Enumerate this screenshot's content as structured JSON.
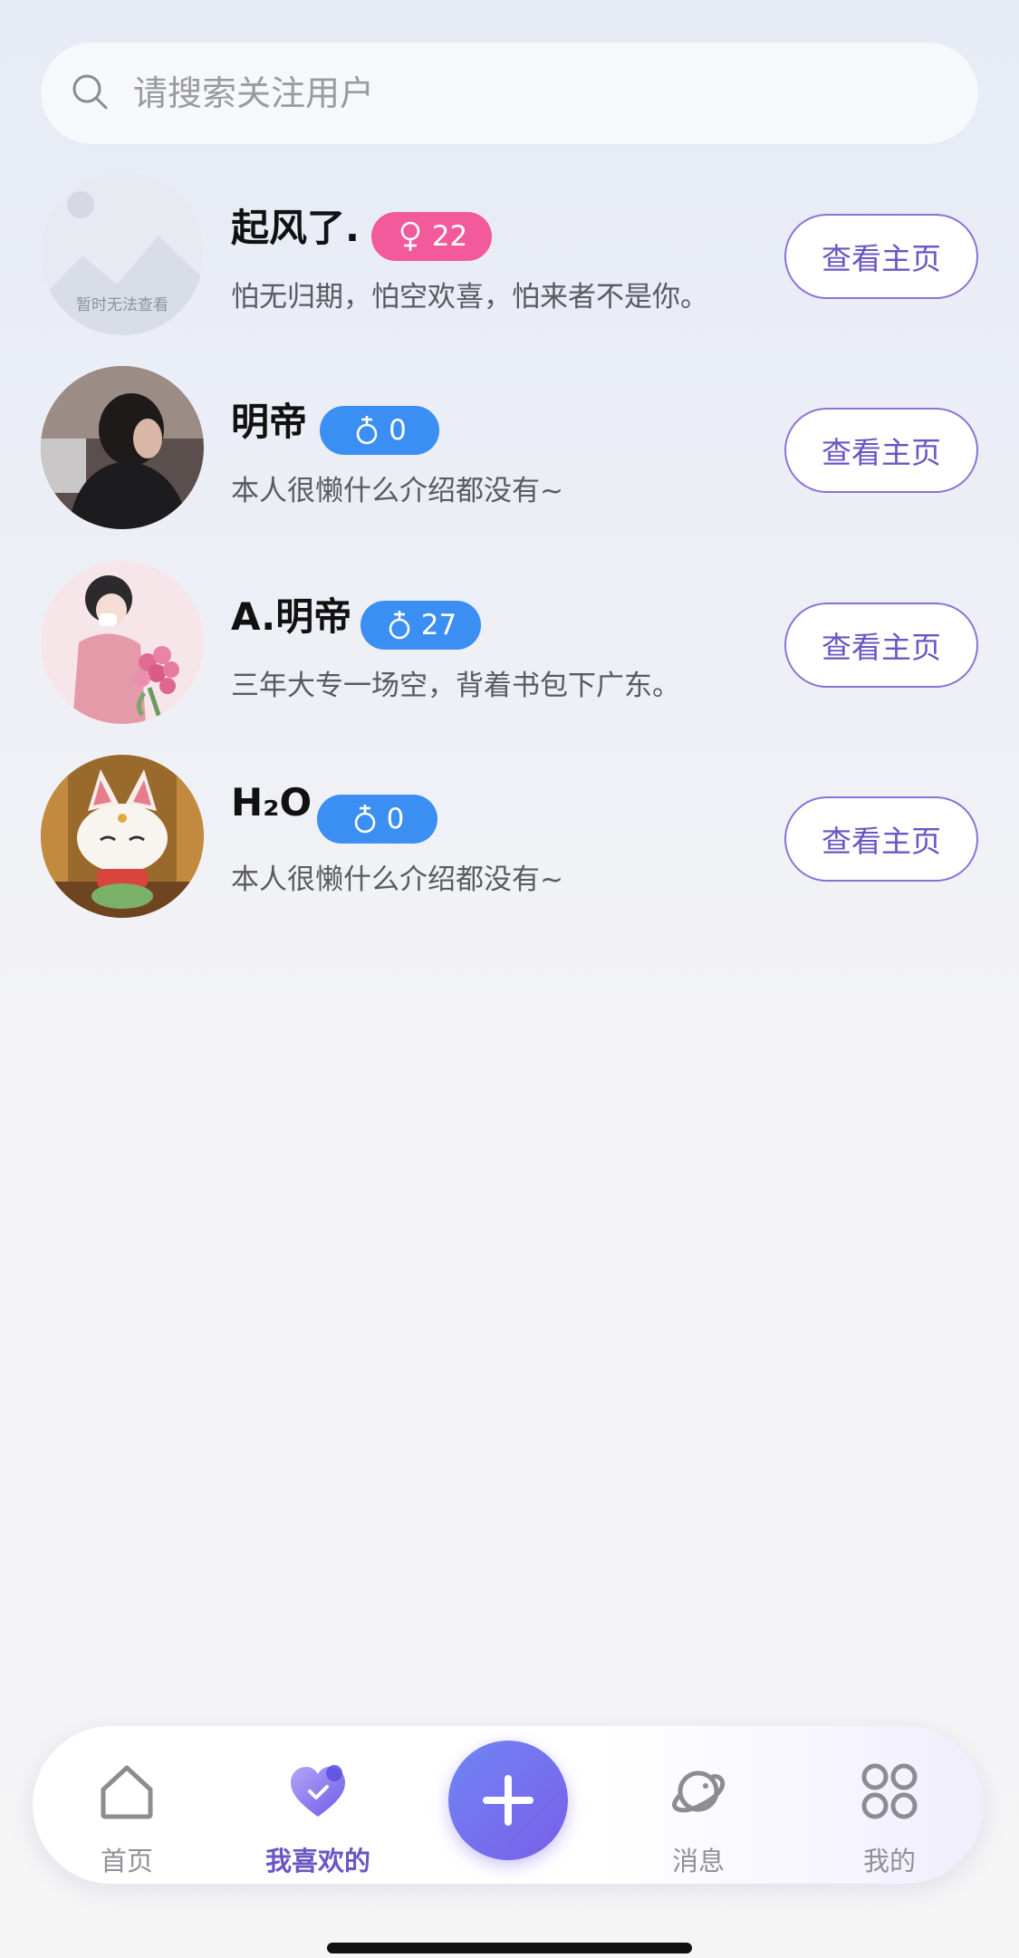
{
  "search": {
    "placeholder": "请搜索关注用户"
  },
  "users": [
    {
      "name": "起风了.",
      "gender": "female",
      "gender_icon": "female-icon",
      "age": "22",
      "bio": "怕无归期，怕空欢喜，怕来者不是你。",
      "avatar": "placeholder",
      "avatar_text": "暂时无法查看",
      "button": "查看主页"
    },
    {
      "name": "明帝",
      "gender": "male",
      "gender_icon": "male-icon",
      "age": "0",
      "bio": "本人很懒什么介绍都没有~",
      "avatar": "photo-person-dark",
      "button": "查看主页"
    },
    {
      "name": "A.明帝",
      "gender": "male",
      "gender_icon": "male-icon",
      "age": "27",
      "bio": "三年大专一场空，背着书包下广东。",
      "avatar": "illustration-boy-flowers",
      "button": "查看主页"
    },
    {
      "name": "H₂O",
      "gender": "male",
      "gender_icon": "male-icon",
      "age": "0",
      "bio": "本人很懒什么介绍都没有~",
      "avatar": "photo-lucky-cat",
      "button": "查看主页"
    }
  ],
  "tabbar": {
    "tabs": [
      {
        "label": "首页",
        "icon": "home-icon",
        "active": false
      },
      {
        "label": "我喜欢的",
        "icon": "heart-icon",
        "active": true
      },
      {
        "label": "",
        "icon": "plus-icon",
        "active": false
      },
      {
        "label": "消息",
        "icon": "planet-icon",
        "active": false
      },
      {
        "label": "我的",
        "icon": "grid-icon",
        "active": false
      }
    ]
  },
  "colors": {
    "accent": "#6a56c4",
    "female_badge": "#f25a9b",
    "male_badge": "#3b8ef2",
    "plus_gradient_start": "#6f86f5",
    "plus_gradient_end": "#7a5ee8"
  }
}
